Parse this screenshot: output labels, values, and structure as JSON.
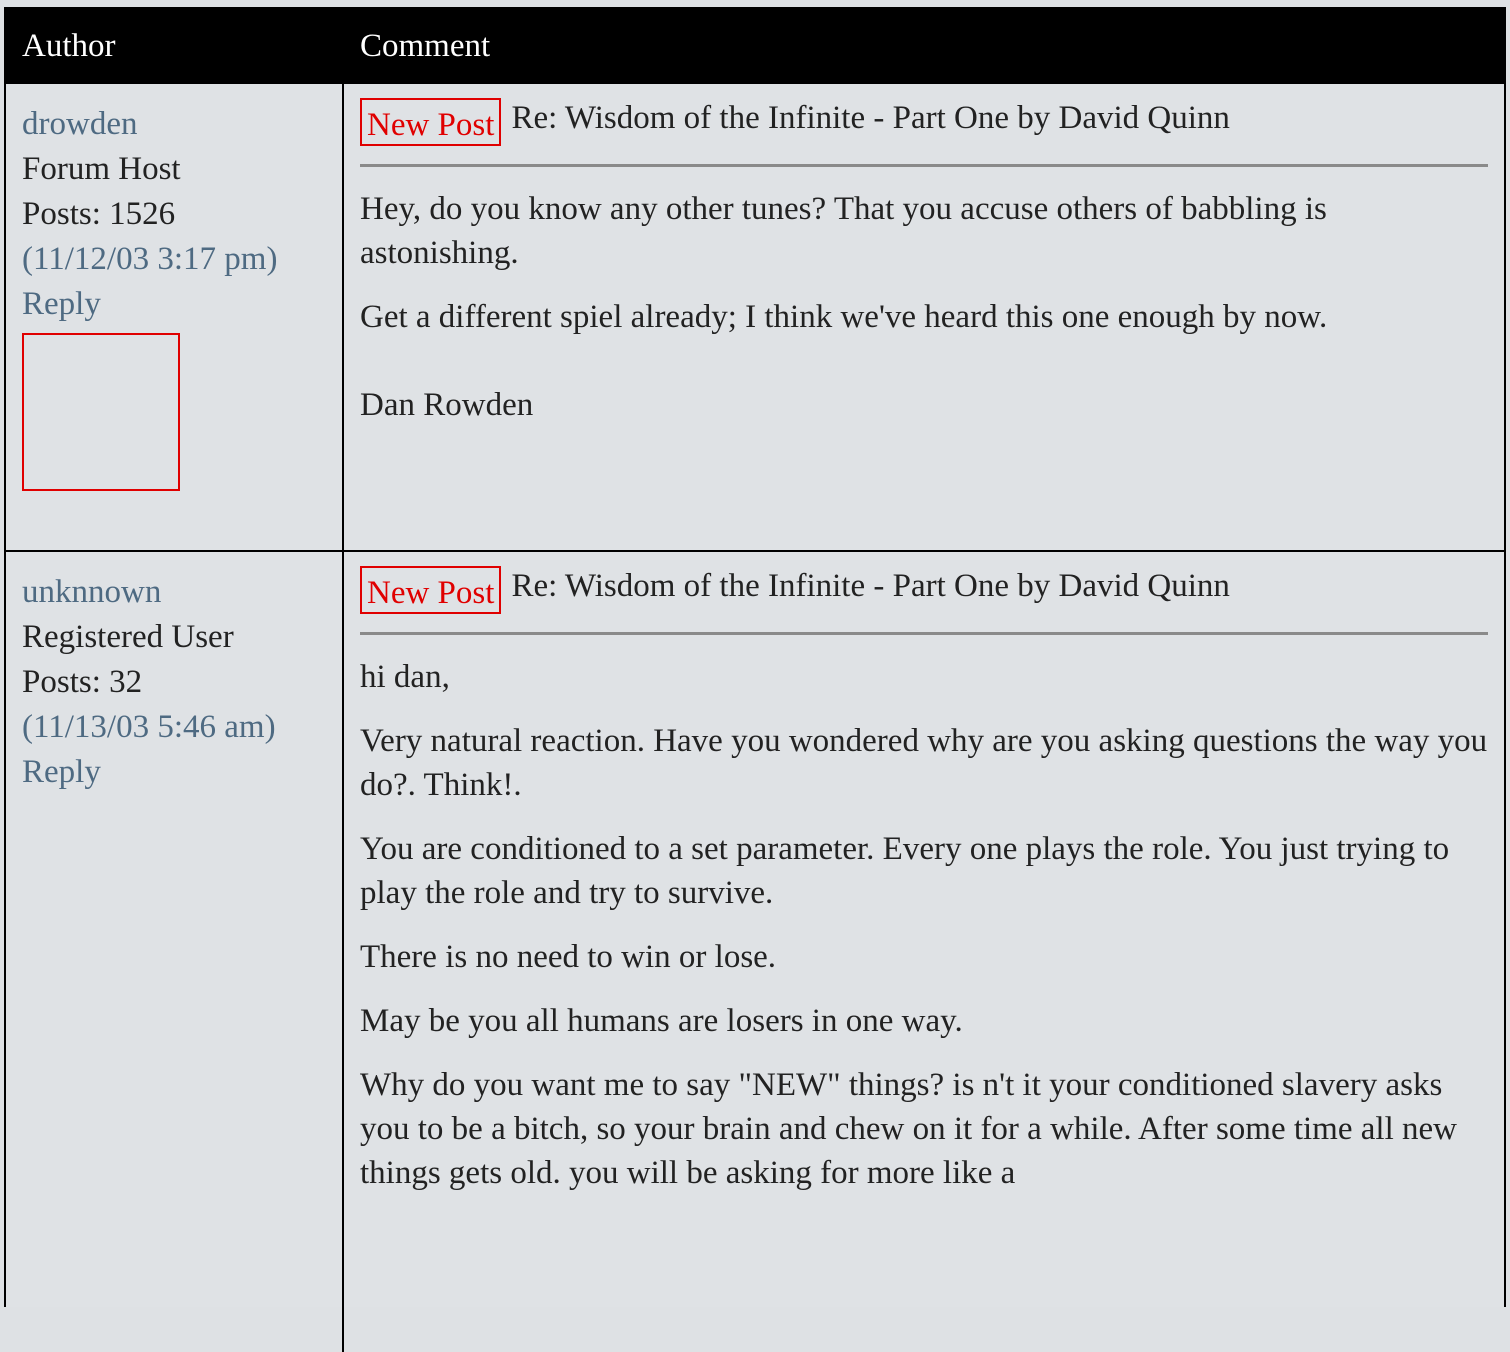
{
  "header": {
    "author": "Author",
    "comment": "Comment"
  },
  "posts": [
    {
      "author": "drowden",
      "role": "Forum Host",
      "posts": "Posts: 1526",
      "date": "(11/12/03 3:17 pm)",
      "reply": "Reply",
      "badge": "New Post",
      "subject": "Re: Wisdom of the Infinite - Part One by David Quinn",
      "paragraphs": [
        "Hey, do you know any other tunes? That you accuse others of babbling is astonishing.",
        "Get a different spiel already; I think we've heard this one enough by now."
      ],
      "signature": "Dan Rowden"
    },
    {
      "author": "unknnown",
      "role": "Registered User",
      "posts": "Posts: 32",
      "date": "(11/13/03 5:46 am)",
      "reply": "Reply",
      "badge": "New Post",
      "subject": "Re: Wisdom of the Infinite - Part One by David Quinn",
      "paragraphs": [
        "hi dan,",
        "Very natural reaction. Have you wondered why are you asking questions the way you do?. Think!.",
        "You are conditioned to a set parameter. Every one plays the role. You just trying to play the role and try to survive.",
        "There is no need to win or lose.",
        "May be you all humans are losers in one way.",
        "Why do you want me to say \"NEW\" things? is n't it your conditioned slavery asks you to be a bitch, so your brain and chew on it for a while. After some time all new things gets old. you will be asking for more like a"
      ]
    }
  ]
}
